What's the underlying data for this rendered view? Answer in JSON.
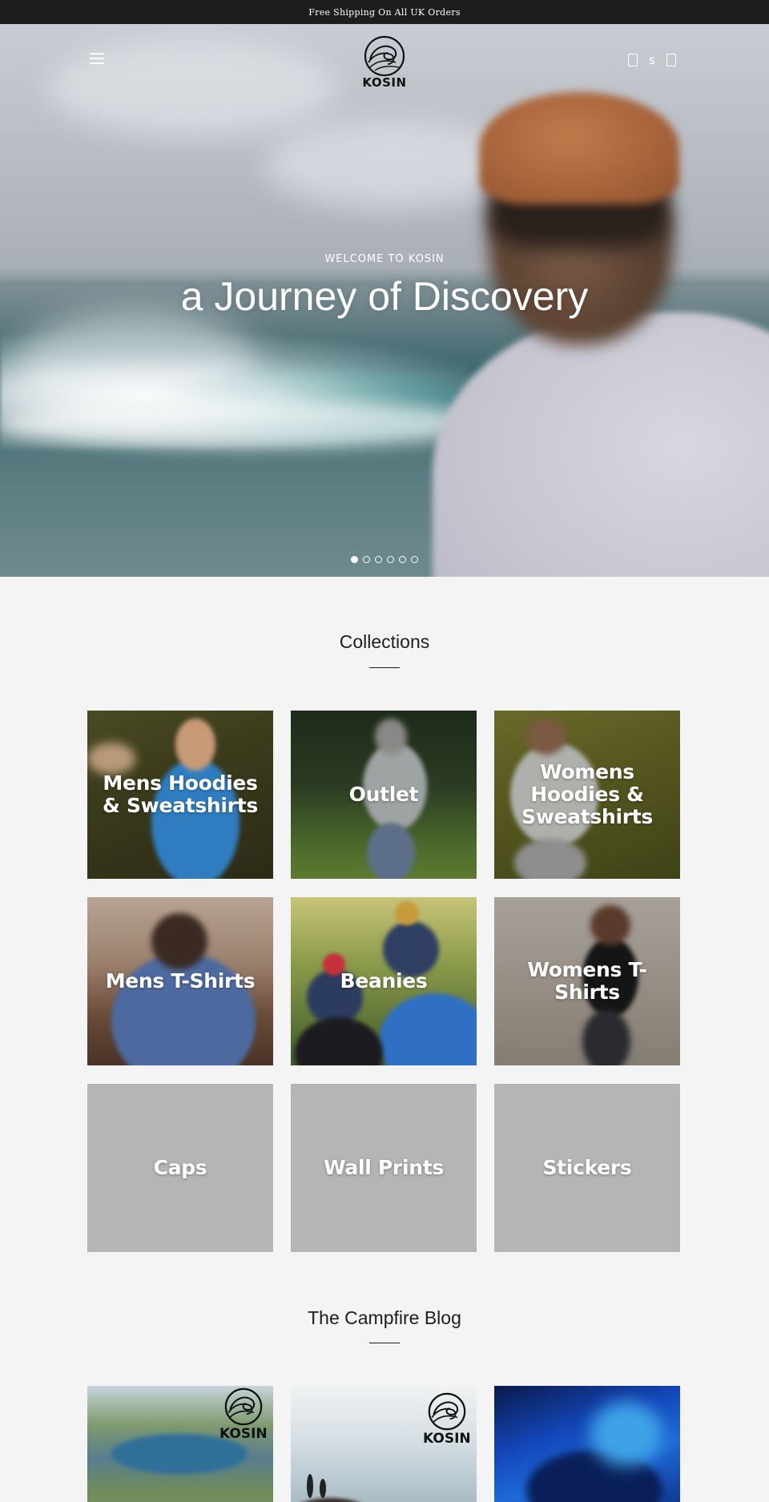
{
  "announcement": "Free Shipping On All UK Orders",
  "header": {
    "logo_text": "KOSIN",
    "search_icon": "search-icon",
    "account_label": "s",
    "cart_icon": "cart-icon"
  },
  "hero": {
    "eyebrow": "WELCOME TO KOSIN",
    "title": "a Journey of Discovery",
    "slides_total": 6,
    "active_slide": 1
  },
  "collections": {
    "title": "Collections",
    "items": [
      {
        "label": "Mens Hoodies & Sweatshirts"
      },
      {
        "label": "Outlet"
      },
      {
        "label": "Womens Hoodies & Sweatshirts"
      },
      {
        "label": "Mens T-Shirts"
      },
      {
        "label": "Beanies"
      },
      {
        "label": "Womens T-Shirts"
      },
      {
        "label": "Caps"
      },
      {
        "label": "Wall Prints"
      },
      {
        "label": "Stickers"
      }
    ]
  },
  "blog": {
    "title": "The Campfire Blog",
    "logo_text": "KOSIN"
  },
  "colors": {
    "announcement_bg": "#1c1d1d",
    "page_bg": "#f4f4f4",
    "placeholder_tile": "#b5b5b5"
  }
}
